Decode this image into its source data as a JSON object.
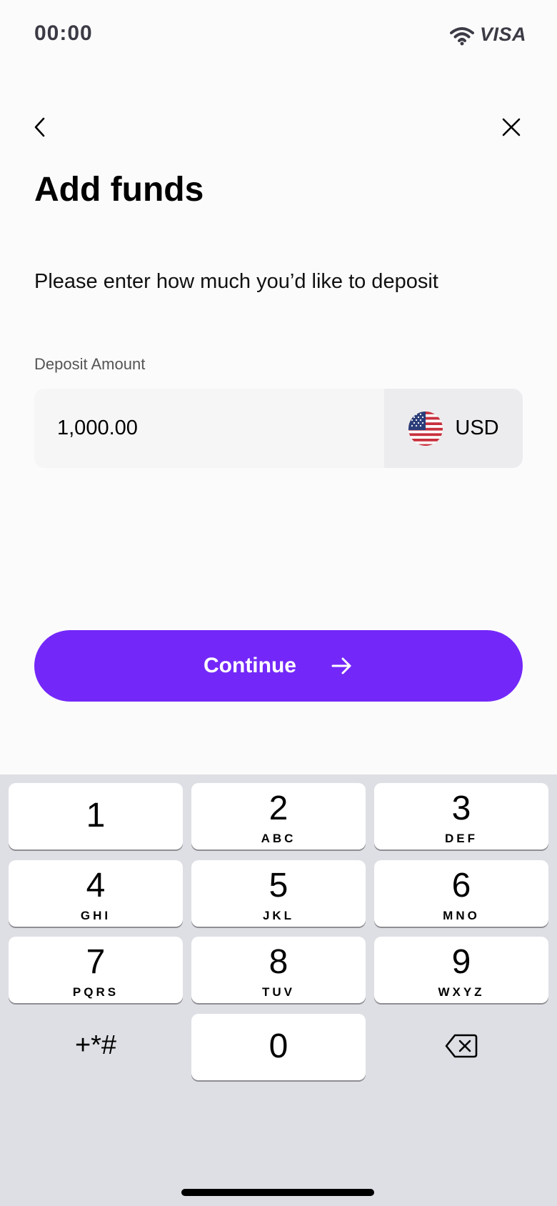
{
  "status_bar": {
    "time": "00:00",
    "carrier": "VISA"
  },
  "header": {
    "title": "Add funds"
  },
  "subtitle": "Please enter how much you’d like to deposit",
  "deposit": {
    "label": "Deposit Amount",
    "amount": "1,000.00",
    "currency": "USD",
    "currency_icon": "us-flag-icon"
  },
  "continue_button": {
    "label": "Continue",
    "icon": "arrow-right-icon"
  },
  "colors": {
    "accent": "#7328f9",
    "keypad_bg": "#dedfe4",
    "field_bg": "#f6f6f7"
  },
  "keypad": {
    "keys": [
      {
        "num": "1",
        "letters": ""
      },
      {
        "num": "2",
        "letters": "ABC"
      },
      {
        "num": "3",
        "letters": "DEF"
      },
      {
        "num": "4",
        "letters": "GHI"
      },
      {
        "num": "5",
        "letters": "JKL"
      },
      {
        "num": "6",
        "letters": "MNO"
      },
      {
        "num": "7",
        "letters": "PQRS"
      },
      {
        "num": "8",
        "letters": "TUV"
      },
      {
        "num": "9",
        "letters": "WXYZ"
      },
      {
        "num": "0",
        "letters": ""
      }
    ],
    "symbols": "+*#"
  }
}
